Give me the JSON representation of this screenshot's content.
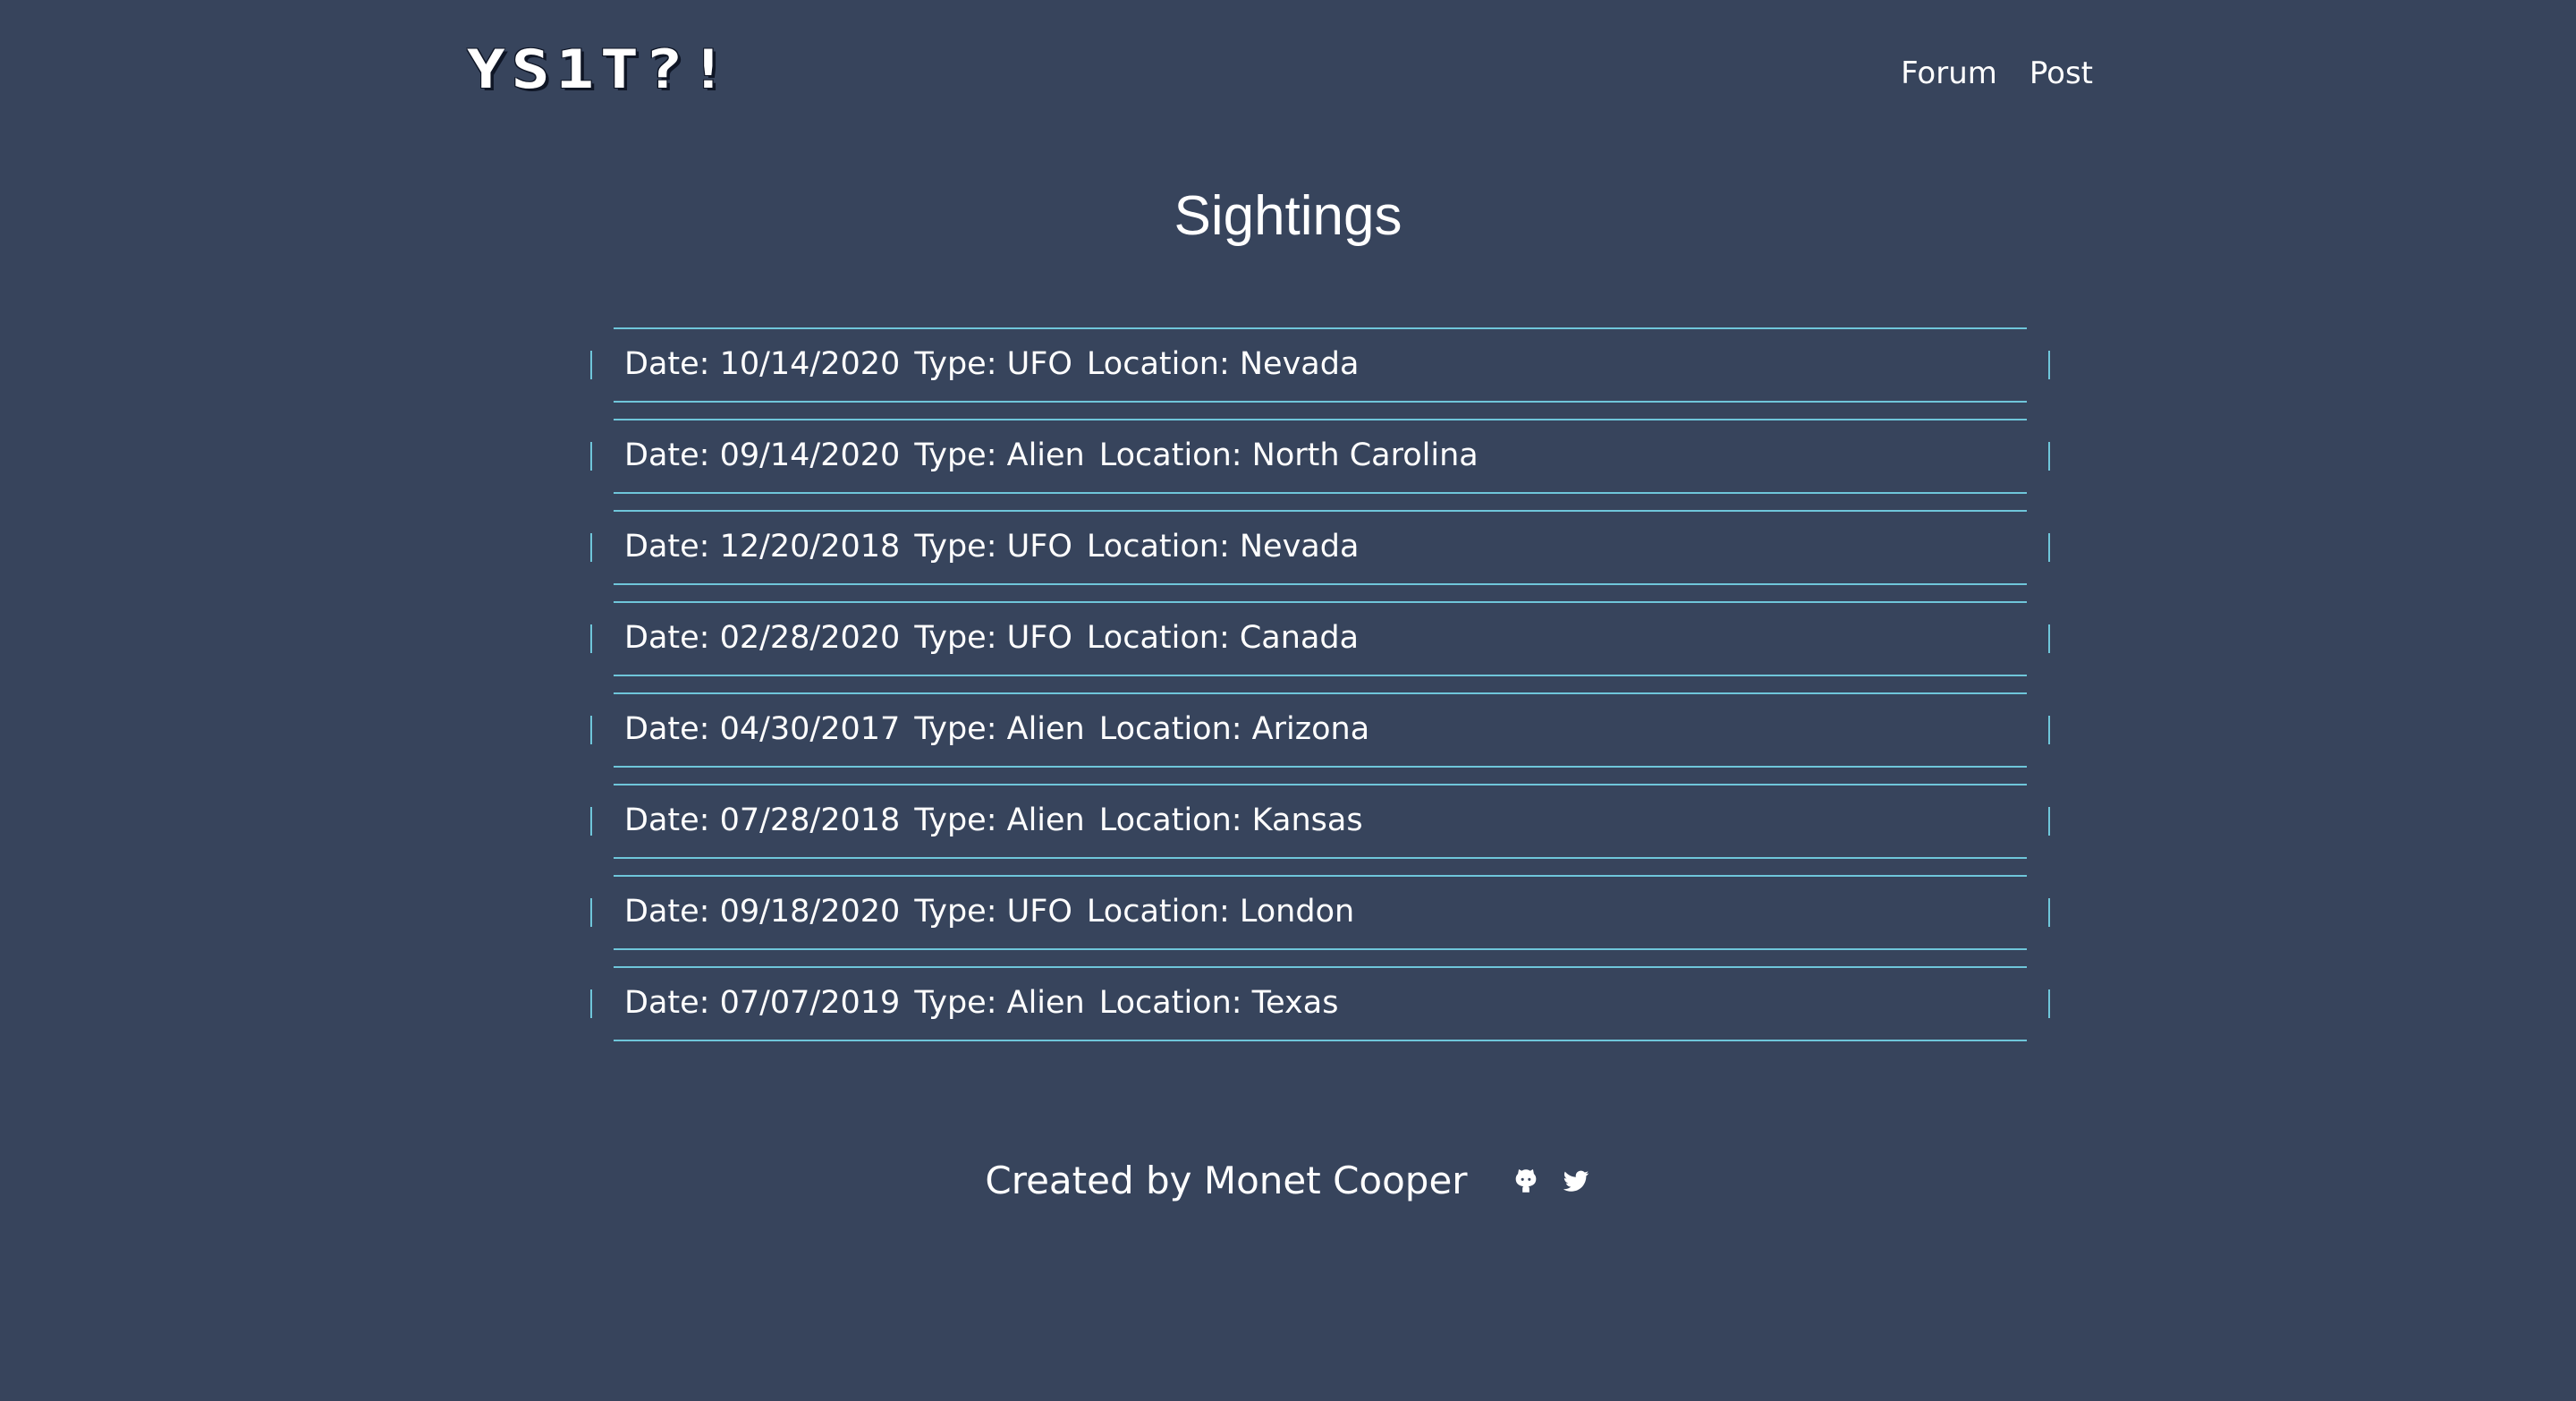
{
  "header": {
    "logo_text": "YS1T?!",
    "nav": [
      {
        "label": "Forum"
      },
      {
        "label": "Post"
      }
    ]
  },
  "page": {
    "title": "Sightings"
  },
  "sightings": [
    {
      "date_label": "Date: 10/14/2020",
      "type_label": "Type: UFO",
      "location_label": "Location: Nevada"
    },
    {
      "date_label": "Date: 09/14/2020",
      "type_label": "Type: Alien",
      "location_label": "Location: North Carolina"
    },
    {
      "date_label": "Date: 12/20/2018",
      "type_label": "Type: UFO",
      "location_label": "Location: Nevada"
    },
    {
      "date_label": "Date: 02/28/2020",
      "type_label": "Type: UFO",
      "location_label": "Location: Canada"
    },
    {
      "date_label": "Date: 04/30/2017",
      "type_label": "Type: Alien",
      "location_label": "Location: Arizona"
    },
    {
      "date_label": "Date: 07/28/2018",
      "type_label": "Type: Alien",
      "location_label": "Location: Kansas"
    },
    {
      "date_label": "Date: 09/18/2020",
      "type_label": "Type: UFO",
      "location_label": "Location: London"
    },
    {
      "date_label": "Date: 07/07/2019",
      "type_label": "Type: Alien",
      "location_label": "Location: Texas"
    }
  ],
  "footer": {
    "credit": "Created by Monet Cooper",
    "icons": [
      "github-icon",
      "twitter-icon"
    ]
  },
  "colors": {
    "background": "#37445c",
    "accent": "#6fc6da",
    "text": "#ffffff"
  }
}
